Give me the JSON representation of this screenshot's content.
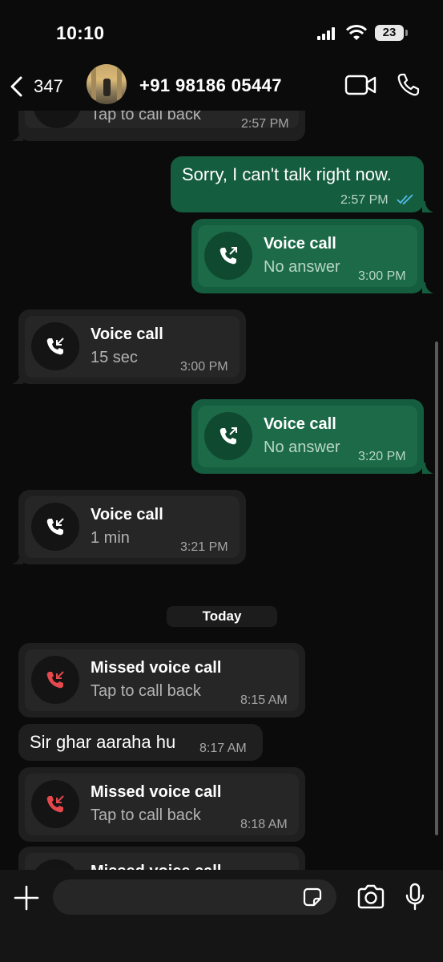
{
  "status_bar": {
    "time": "10:10",
    "battery": "23"
  },
  "header": {
    "back_count": "347",
    "contact": "+91 98186 05447"
  },
  "messages": {
    "m0": {
      "subtitle": "Tap to call back",
      "time": "2:57 PM"
    },
    "m1": {
      "text": "Sorry, I can't talk right now.",
      "time": "2:57 PM"
    },
    "m2": {
      "title": "Voice call",
      "subtitle": "No answer",
      "time": "3:00 PM"
    },
    "m3": {
      "title": "Voice call",
      "subtitle": "15 sec",
      "time": "3:00 PM"
    },
    "m4": {
      "title": "Voice call",
      "subtitle": "No answer",
      "time": "3:20 PM"
    },
    "m5": {
      "title": "Voice call",
      "subtitle": "1 min",
      "time": "3:21 PM"
    },
    "day_separator": "Today",
    "m6": {
      "title": "Missed voice call",
      "subtitle": "Tap to call back",
      "time": "8:15 AM"
    },
    "m7": {
      "text": "Sir ghar aaraha hu",
      "time": "8:17 AM"
    },
    "m8": {
      "title": "Missed voice call",
      "subtitle": "Tap to call back",
      "time": "8:18 AM"
    },
    "m9": {
      "title": "Missed voice call"
    }
  },
  "colors": {
    "background": "#0b0b0b",
    "incoming_bubble": "#1f1f1f",
    "outgoing_bubble": "#155d3f",
    "missed_call_red": "#e5484d",
    "read_ticks": "#53bdeb"
  },
  "icons": {
    "back": "chevron-left-icon",
    "video": "video-camera-icon",
    "phone": "phone-icon",
    "outgoing_call": "phone-outgoing-arrow-icon",
    "incoming_call": "phone-incoming-arrow-icon",
    "missed_call": "phone-missed-arrow-icon",
    "attach": "plus-icon",
    "sticker": "sticker-icon",
    "camera": "camera-icon",
    "mic": "microphone-icon"
  }
}
